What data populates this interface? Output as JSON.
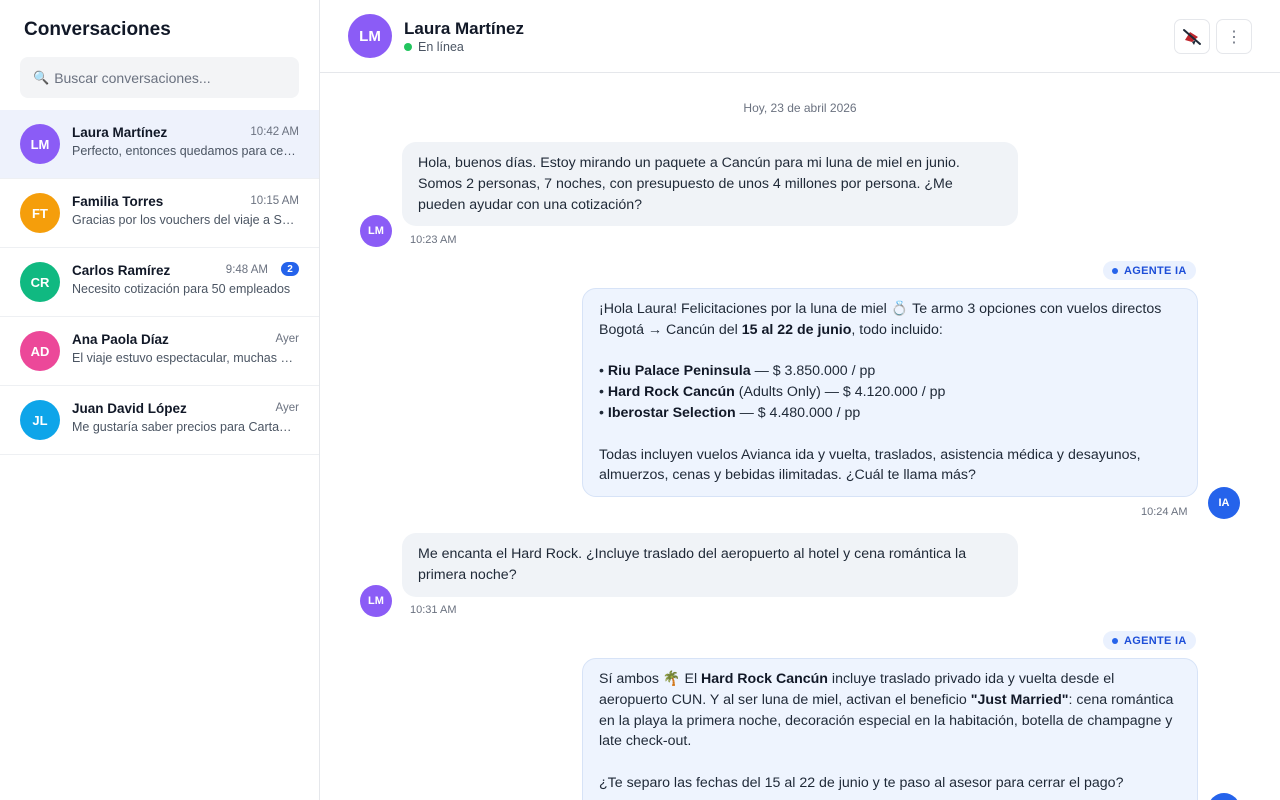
{
  "sidebar": {
    "title": "Conversaciones",
    "search_placeholder": "Buscar conversaciones...",
    "conversations": [
      {
        "initials": "LM",
        "name": "Laura Martínez",
        "time": "10:42 AM",
        "preview": "Perfecto, entonces quedamos para cerrar el pago",
        "color": "#8b5cf6",
        "active": true
      },
      {
        "initials": "FT",
        "name": "Familia Torres",
        "time": "10:15 AM",
        "preview": "Gracias por los vouchers del viaje a San Andrés",
        "color": "#f59e0b"
      },
      {
        "initials": "CR",
        "name": "Carlos Ramírez",
        "time": "9:48 AM",
        "preview": "Necesito cotización para 50 empleados",
        "color": "#10b981",
        "badge": "2"
      },
      {
        "initials": "AD",
        "name": "Ana Paola Díaz",
        "time": "Ayer",
        "preview": "El viaje estuvo espectacular, muchas gracias",
        "color": "#ec4899"
      },
      {
        "initials": "JL",
        "name": "Juan David López",
        "time": "Ayer",
        "preview": "Me gustaría saber precios para Cartagena",
        "color": "#0ea5e9"
      }
    ]
  },
  "chat": {
    "contact": {
      "initials": "LM",
      "name": "Laura Martínez",
      "status": "En línea",
      "color": "#8b5cf6"
    },
    "date_separator": "Hoy, 23 de abril 2026",
    "agent_label": "AGENTE IA",
    "agent_initials": "IA",
    "agent_color": "#2563eb",
    "more_icon": "⋮",
    "messages": {
      "m1": {
        "l1": "Hola, buenos días. Estoy mirando un paquete a Cancún para mi luna de miel en junio.",
        "l2": "Somos 2 personas, 7 noches, con presupuesto de unos 4 millones por persona. ¿Me",
        "l3": "pueden ayudar con una cotización?",
        "time": "10:23 AM"
      },
      "m2": {
        "l1": "¡Hola Laura! Felicitaciones por la luna de miel 💍 Te armo 3 opciones con vuelos directos",
        "l2a": "Bogotá → Cancún del ",
        "l2b": "15 al 22 de junio",
        "l2c": ", todo incluido:",
        "o1a": "• ",
        "o1b": "Riu Palace Peninsula",
        "o1c": " — $ 3.850.000 / pp",
        "o2a": "• ",
        "o2b": "Hard Rock Cancún",
        "o2c": " (Adults Only) — $ 4.120.000 / pp",
        "o3a": "• ",
        "o3b": "Iberostar Selection",
        "o3c": " — $ 4.480.000 / pp",
        "l4": "Todas incluyen vuelos Avianca ida y vuelta, traslados, asistencia médica y desayunos,",
        "l5": "almuerzos, cenas y bebidas ilimitadas. ¿Cuál te llama más?",
        "time": "10:24 AM"
      },
      "m3": {
        "l1": "Me encanta el Hard Rock. ¿Incluye traslado del aeropuerto al hotel y cena romántica la",
        "l2": "primera noche?",
        "time": "10:31 AM"
      },
      "m4": {
        "l1a": "Sí ambos 🌴 El ",
        "l1b": "Hard Rock Cancún",
        "l1c": " incluye traslado privado ida y vuelta desde el",
        "l2a": "aeropuerto CUN. Y al ser luna de miel, activan el beneficio ",
        "l2b": "\"Just Married\"",
        "l2c": ": cena romántica",
        "l3": "en la playa la primera noche, decoración especial en la habitación, botella de champagne y",
        "l4": "late check-out.",
        "l5": "¿Te separo las fechas del 15 al 22 de junio y te paso al asesor para cerrar el pago?"
      }
    }
  }
}
